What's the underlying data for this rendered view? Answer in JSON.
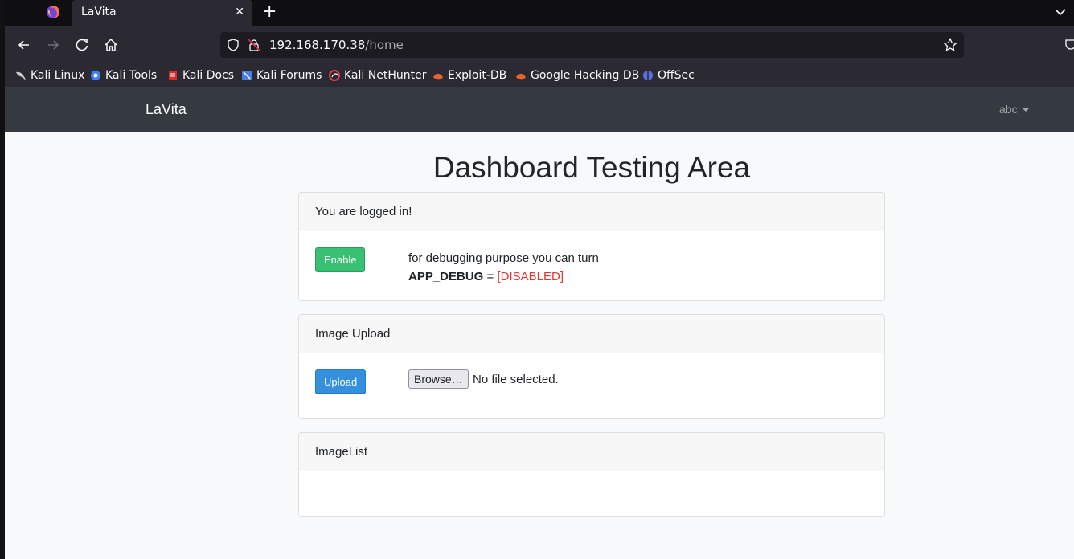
{
  "browser": {
    "tab_title": "LaVita",
    "tab_close_glyph": "✕",
    "new_tab_glyph": "+",
    "url_host": "192.168.170.38",
    "url_path": "/home",
    "bookmarks": [
      {
        "label": "Kali Linux",
        "icon": "kali-dragon-icon",
        "color": "#cccccc"
      },
      {
        "label": "Kali Tools",
        "icon": "kali-tools-icon",
        "color": "#3c82f0"
      },
      {
        "label": "Kali Docs",
        "icon": "kali-docs-icon",
        "color": "#d62b2b"
      },
      {
        "label": "Kali Forums",
        "icon": "kali-forums-icon",
        "color": "#4a7fe0"
      },
      {
        "label": "Kali NetHunter",
        "icon": "nethunter-icon",
        "color": "#e0404a"
      },
      {
        "label": "Exploit-DB",
        "icon": "exploit-db-icon",
        "color": "#e5652e"
      },
      {
        "label": "Google Hacking DB",
        "icon": "ghdb-icon",
        "color": "#e5652e"
      },
      {
        "label": "OffSec",
        "icon": "offsec-icon",
        "color": "#5b6ee1"
      }
    ]
  },
  "app": {
    "brand": "LaVita",
    "user": "abc",
    "title": "Dashboard Testing Area",
    "cards": {
      "status": {
        "header": "You are logged in!",
        "button": "Enable",
        "line1": "for debugging purpose you can turn",
        "debug_key": "APP_DEBUG",
        "equals": " = ",
        "debug_value": "[DISABLED]"
      },
      "upload": {
        "header": "Image Upload",
        "button": "Upload",
        "browse": "Browse…",
        "no_file": "No file selected."
      },
      "list": {
        "header": "ImageList"
      }
    }
  },
  "colors": {
    "success": "#38c172",
    "primary": "#3490dc",
    "danger": "#e3342f",
    "navbar": "#343a40"
  }
}
